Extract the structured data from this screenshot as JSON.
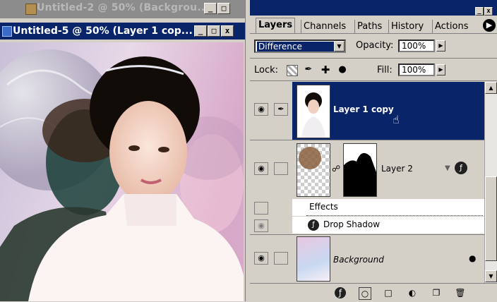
{
  "back_window": {
    "title": "Untitled-2 @ 50% (Backgrou..."
  },
  "doc_window": {
    "title": "Untitled-5 @ 50% (Layer 1 cop..."
  },
  "window_buttons": {
    "minimize": "_",
    "maximize": "□",
    "close": "x"
  },
  "palette": {
    "tabs": [
      "Layers",
      "Channels",
      "Paths",
      "History",
      "Actions"
    ],
    "active_tab": "Layers",
    "blend_mode": "Difference",
    "opacity_label": "Opacity:",
    "opacity_value": "100%",
    "lock_label": "Lock:",
    "fill_label": "Fill:",
    "fill_value": "100%",
    "layers": [
      {
        "name": "Layer 1 copy",
        "selected": true
      },
      {
        "name": "Layer 2",
        "selected": false
      },
      {
        "name": "Background",
        "selected": false
      }
    ],
    "effects_label": "Effects",
    "drop_shadow_label": "Drop Shadow"
  },
  "colors": {
    "selected": "#0a246a",
    "panel": "#d4d0c8"
  }
}
